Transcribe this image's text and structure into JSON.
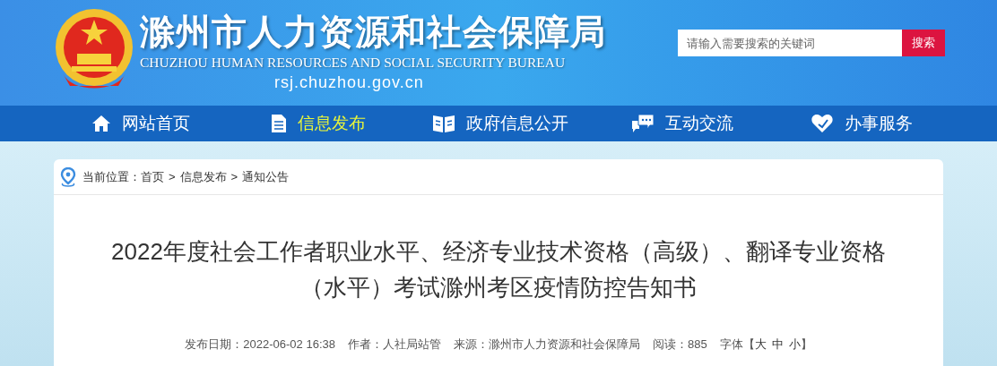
{
  "header": {
    "title": "滁州市人力资源和社会保障局",
    "subtitle": "CHUZHOU HUMAN RESOURCES AND SOCIAL SECURITY BUREAU",
    "domain": "rsj.chuzhou.gov.cn"
  },
  "search": {
    "placeholder": "请输入需要搜索的关键词",
    "button": "搜索"
  },
  "nav": [
    {
      "kind": "home",
      "label": "网站首页",
      "selected": false
    },
    {
      "kind": "doc",
      "label": "信息发布",
      "selected": true
    },
    {
      "kind": "book",
      "label": "政府信息公开",
      "selected": false
    },
    {
      "kind": "chat",
      "label": "互动交流",
      "selected": false
    },
    {
      "kind": "heart",
      "label": "办事服务",
      "selected": false
    }
  ],
  "breadcrumb": {
    "label": "当前位置：",
    "items": [
      "首页",
      "信息发布",
      "通知公告"
    ],
    "separator": ">"
  },
  "article": {
    "title": "2022年度社会工作者职业水平、经济专业技术资格（高级）、翻译专业资格（水平）考试滁州考区疫情防控告知书",
    "meta": [
      "发布日期：2022-06-02 16:38",
      "作者：人社局站管",
      "来源：滁州市人力资源和社会保障局",
      "阅读：885"
    ],
    "font_size": {
      "label": "字体",
      "open": "【",
      "options": [
        "大",
        "中",
        "小"
      ],
      "close": "】"
    }
  }
}
